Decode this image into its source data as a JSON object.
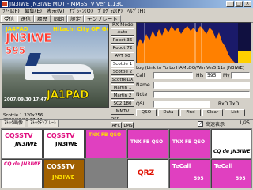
{
  "window": {
    "title": "JN3IWE JN3IWE MDT - MMSSTV Ver 1.13C"
  },
  "menu": [
    "ﾌｧｲﾙ(F)",
    "編集(E)",
    "表示(V)",
    "ｵﾌﾟｼｮﾝ(O)",
    "ﾌﾟﾛｸﾞﾗﾑ(P)",
    "ﾍﾙﾌﾟ(H)"
  ],
  "tabs": [
    "受信",
    "送信",
    "履歴",
    "同期",
    "設定",
    "テンプレート"
  ],
  "picture": {
    "top_left": "JA4PAD",
    "callsign": "JN3IWE",
    "number": "595",
    "location": "Hitachi City OP Gotoh",
    "bottom": "JA1PAD",
    "date": "2007/09/30 17:47"
  },
  "status": {
    "line1": "Scottie 1 320x256",
    "line2": "2007/09/30 17:47"
  },
  "rx_mode": {
    "label": "RX Mode",
    "buttons": [
      "Auto",
      "Robot 36",
      "Robot 72",
      "AVT 90",
      "Scottie 1",
      "Scottie 2",
      "ScottieDX",
      "Martin 1",
      "Martin 2",
      "SC2 180",
      "MMTV"
    ],
    "selected": "Scottie 1"
  },
  "dsp": {
    "label": "DSP",
    "buttons": [
      "AFC",
      "LMS"
    ]
  },
  "log": {
    "link_text": "Log (Link to Turbo HAMLOG/Win Ver5.11a  JN3IWE)",
    "call_label": "Call",
    "his_label": "His",
    "my_label": "My",
    "his_value": "595",
    "my_value": "",
    "name_label": "Name",
    "note_label": "Note",
    "qsl_label": "QSL",
    "qsl_value": "",
    "rxdtx_label": "RxD TxD",
    "buttons": [
      "QSO",
      "Data",
      "Find",
      "Clear",
      "List"
    ]
  },
  "template_bar": {
    "tab1": "ｽﾄｯｸ画像",
    "tab2": "ｽﾄｯｸﾃﾝﾌﾟﾚｰﾄ",
    "checkbox_label": "高速表示",
    "page": "1/25"
  },
  "thumbnails": [
    {
      "title": "CQSSTV",
      "call": "JN3IWE",
      "footer": "CQ de JN3IWE"
    },
    {
      "title": "CQSSTV",
      "call": "JN3IWE",
      "footer": ""
    },
    {
      "title": "TNX FB QSO",
      "call": "",
      "footer": ""
    },
    {
      "title": "TNX FB QSO",
      "call": "",
      "footer": ""
    },
    {
      "title": "TNX FB QSO",
      "call": "",
      "footer": ""
    },
    {
      "title": "CQ de JN3IWE",
      "call": "",
      "footer": ""
    },
    {
      "title": "CQSSTV",
      "call": "JN3IWE",
      "footer": ""
    },
    {
      "title": "QRZ",
      "call": "",
      "footer": ""
    },
    {
      "title": "TeCall",
      "call": "595",
      "footer": ""
    },
    {
      "title": "TeCall",
      "call": "595",
      "footer": ""
    }
  ],
  "colors": {
    "accent": "#0a246a",
    "thumb_magenta": "#e040c0",
    "thumb_olive": "#a06000"
  }
}
